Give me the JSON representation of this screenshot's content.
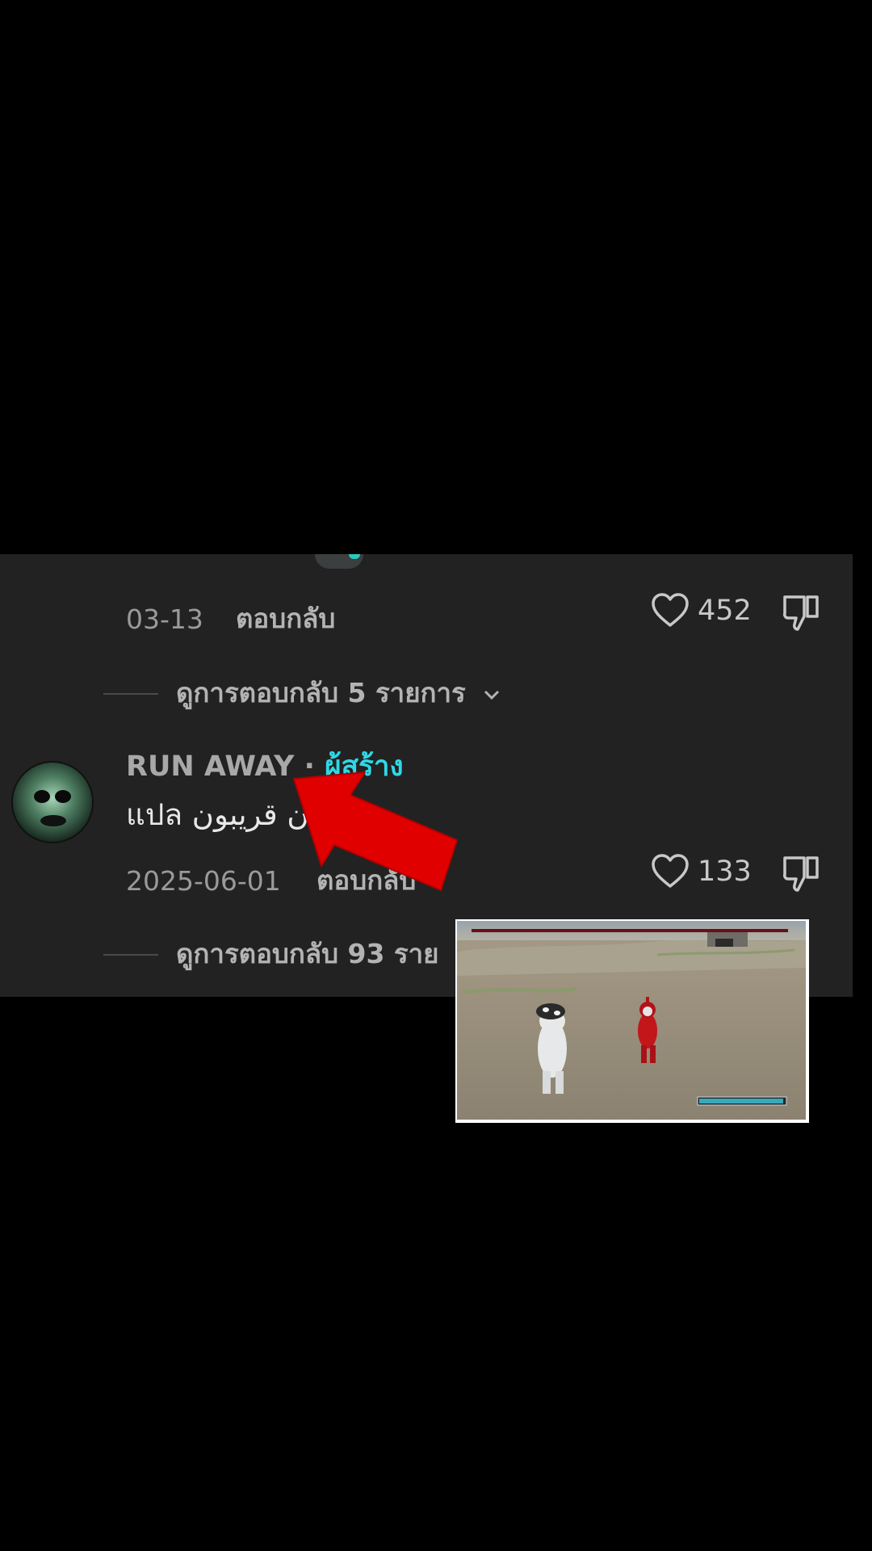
{
  "comments": [
    {
      "date": "03-13",
      "reply_label": "ตอบกลับ",
      "likes": "452",
      "view_replies_label": "ดูการตอบกลับ 5 รายการ"
    },
    {
      "username": "RUN AWAY",
      "separator": " · ",
      "creator_badge": "ผู้สร้าง",
      "text": "แปล ن قريبون",
      "date": "2025-06-01",
      "reply_label": "ตอบกลับ",
      "likes": "133",
      "view_replies_label": "ดูการตอบกลับ 93 ราย"
    }
  ],
  "icons": {
    "like": "heart-icon",
    "dislike": "thumbs-down-icon",
    "expand": "chevron-down-icon",
    "annotation": "red-arrow"
  },
  "colors": {
    "panel_bg": "#222222",
    "creator_accent": "#2fd8e6",
    "arrow": "#e00000"
  }
}
